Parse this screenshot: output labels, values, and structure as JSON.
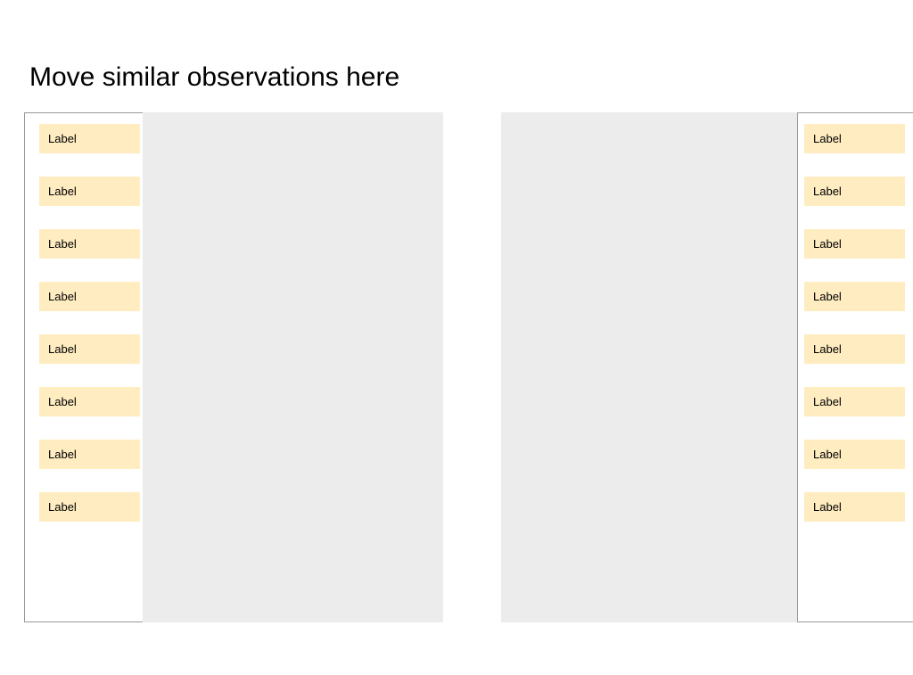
{
  "title": "Move similar observations here",
  "colors": {
    "label_bg": "#ffecc0",
    "dropzone_bg": "#ececec",
    "frame_border": "#999999"
  },
  "left_labels": [
    {
      "text": "Label"
    },
    {
      "text": "Label"
    },
    {
      "text": "Label"
    },
    {
      "text": "Label"
    },
    {
      "text": "Label"
    },
    {
      "text": "Label"
    },
    {
      "text": "Label"
    },
    {
      "text": "Label"
    }
  ],
  "right_labels": [
    {
      "text": "Label"
    },
    {
      "text": "Label"
    },
    {
      "text": "Label"
    },
    {
      "text": "Label"
    },
    {
      "text": "Label"
    },
    {
      "text": "Label"
    },
    {
      "text": "Label"
    },
    {
      "text": "Label"
    }
  ]
}
